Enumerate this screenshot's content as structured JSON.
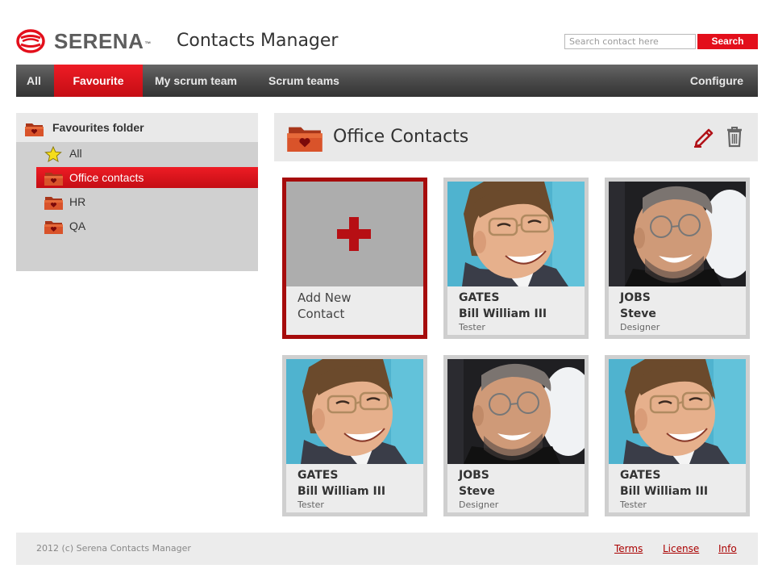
{
  "brand": {
    "name": "SERENA",
    "trademark": "™",
    "app_title": "Contacts Manager",
    "accent": "#e30f1b"
  },
  "search": {
    "placeholder": "Search contact here",
    "value": "",
    "button_label": "Search"
  },
  "nav": {
    "items": [
      {
        "label": "All"
      },
      {
        "label": "Favourite",
        "active": true
      },
      {
        "label": "My scrum team"
      },
      {
        "label": "Scrum teams"
      }
    ],
    "configure_label": "Configure"
  },
  "sidebar": {
    "title": "Favourites folder",
    "items": [
      {
        "label": "All",
        "icon": "star-icon"
      },
      {
        "label": "Office contacts",
        "icon": "folder-heart-icon",
        "active": true
      },
      {
        "label": "HR",
        "icon": "folder-heart-icon"
      },
      {
        "label": "QA",
        "icon": "folder-heart-icon"
      }
    ]
  },
  "main": {
    "title": "Office Contacts",
    "edit_icon": "pencil-icon",
    "delete_icon": "trash-icon",
    "add_card": {
      "line1": "Add New",
      "line2": "Contact",
      "icon": "plus-icon"
    },
    "contacts": [
      {
        "last": "GATES",
        "first": "Bill William III",
        "role": "Tester",
        "photo": "photo-gates"
      },
      {
        "last": "JOBS",
        "first": "Steve",
        "role": "Designer",
        "photo": "photo-jobs"
      },
      {
        "last": "GATES",
        "first": "Bill William III",
        "role": "Tester",
        "photo": "photo-gates"
      },
      {
        "last": "JOBS",
        "first": "Steve",
        "role": "Designer",
        "photo": "photo-jobs"
      },
      {
        "last": "GATES",
        "first": "Bill William III",
        "role": "Tester",
        "photo": "photo-gates"
      }
    ]
  },
  "footer": {
    "copyright": "2012 (c) Serena Contacts Manager",
    "links": [
      "Terms",
      "License",
      "Info"
    ]
  }
}
